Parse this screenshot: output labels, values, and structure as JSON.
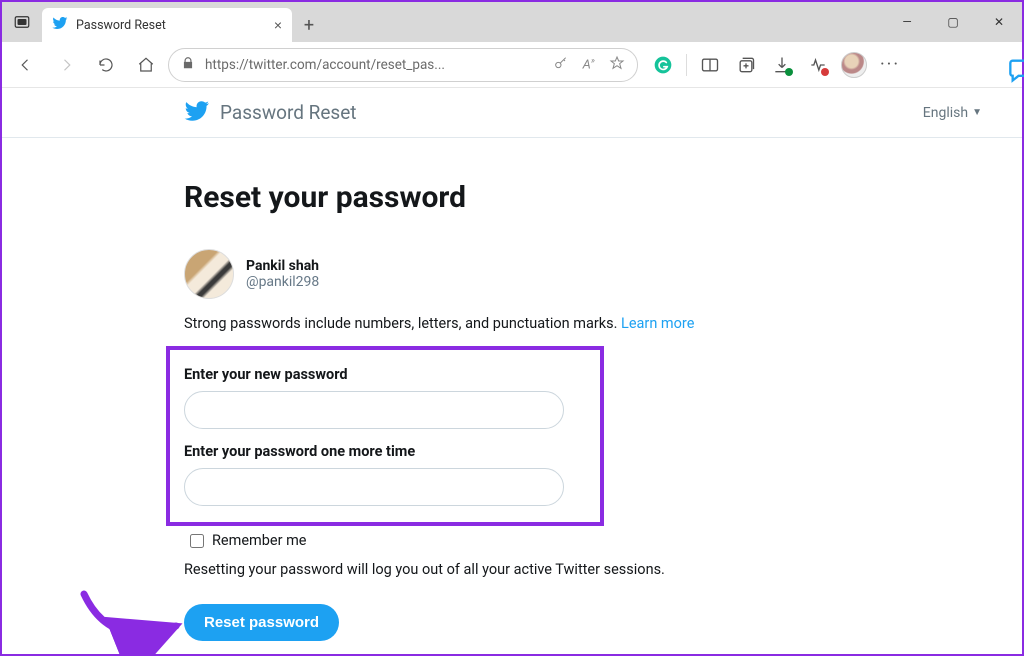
{
  "browser": {
    "tab_title": "Password Reset",
    "url": "https://twitter.com/account/reset_pas...",
    "window_controls": {
      "minimize": "—",
      "maximize": "▢",
      "close": "✕"
    }
  },
  "header": {
    "title": "Password Reset",
    "language": "English"
  },
  "content": {
    "heading": "Reset your password",
    "user_display_name": "Pankil shah",
    "user_handle": "@pankil298",
    "hint_text": "Strong passwords include numbers, letters, and punctuation marks. ",
    "hint_link": "Learn more",
    "field1_label": "Enter your new password",
    "field2_label": "Enter your password one more time",
    "remember_label": "Remember me",
    "note": "Resetting your password will log you out of all your active Twitter sessions.",
    "submit_label": "Reset password"
  },
  "colors": {
    "twitter_blue": "#1da1f2",
    "annotation_purple": "#8a2be2"
  }
}
